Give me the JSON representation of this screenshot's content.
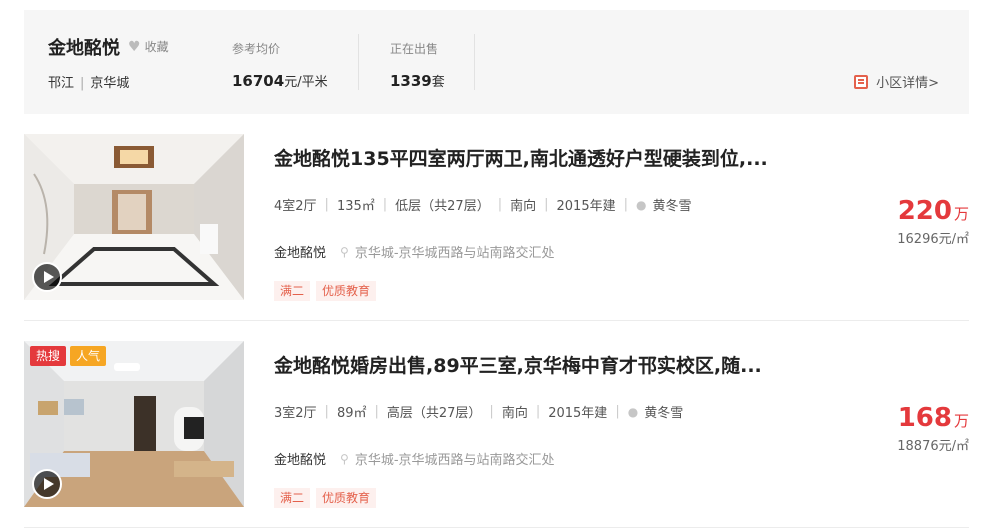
{
  "community": {
    "name": "金地酩悦",
    "favorite_label": "收藏",
    "district": "邗江",
    "area": "京华城",
    "avg_price_label": "参考均价",
    "avg_price": "16704",
    "avg_price_unit": "元/平米",
    "on_sale_label": "正在出售",
    "on_sale_count": "1339",
    "on_sale_unit": "套",
    "detail_link": "小区详情>"
  },
  "listings": [
    {
      "title": "金地酩悦135平四室两厅两卫,南北通透好户型硬装到位,...",
      "layout": "4室2厅",
      "size": "135㎡",
      "floor": "低层（共27层）",
      "orientation": "南向",
      "year": "2015年建",
      "agent": "黄冬雪",
      "community": "金地酩悦",
      "location": "京华城-京华城西路与站南路交汇处",
      "tags": [
        "满二",
        "优质教育"
      ],
      "badges": [],
      "total_price": "220",
      "total_unit": "万",
      "unit_price": "16296元/㎡"
    },
    {
      "title": "金地酩悦婚房出售,89平三室,京华梅中育才邗实校区,随...",
      "layout": "3室2厅",
      "size": "89㎡",
      "floor": "高层（共27层）",
      "orientation": "南向",
      "year": "2015年建",
      "agent": "黄冬雪",
      "community": "金地酩悦",
      "location": "京华城-京华城西路与站南路交汇处",
      "tags": [
        "满二",
        "优质教育"
      ],
      "badges": [
        "热搜",
        "人气"
      ],
      "total_price": "168",
      "total_unit": "万",
      "unit_price": "18876元/㎡"
    }
  ],
  "colors": {
    "accent_red": "#e4393c",
    "tag_red": "#e4614c",
    "badge_orange": "#f6a623"
  }
}
